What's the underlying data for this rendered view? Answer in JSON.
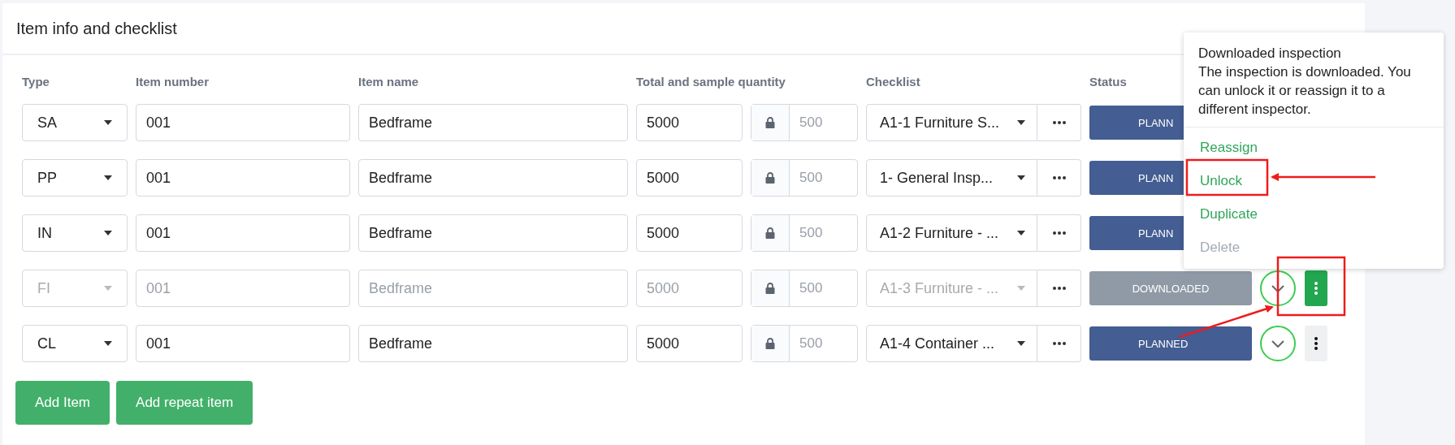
{
  "card": {
    "title": "Item info and checklist"
  },
  "columns": [
    "Type",
    "Item number",
    "Item name",
    "Total and sample quantity",
    "Checklist",
    "Status"
  ],
  "rows": [
    {
      "type": "SA",
      "item_number": "001",
      "item_name": "Bedframe",
      "total_quantity": "5000",
      "sample_quantity": "500",
      "checklist": "A1-1 Furniture S...",
      "status": {
        "kind": "planned",
        "label": "PLANN"
      },
      "disabled": false
    },
    {
      "type": "PP",
      "item_number": "001",
      "item_name": "Bedframe",
      "total_quantity": "5000",
      "sample_quantity": "500",
      "checklist": "1- General Insp...",
      "status": {
        "kind": "planned",
        "label": "PLANN"
      },
      "disabled": false
    },
    {
      "type": "IN",
      "item_number": "001",
      "item_name": "Bedframe",
      "total_quantity": "5000",
      "sample_quantity": "500",
      "checklist": "A1-2 Furniture - ...",
      "status": {
        "kind": "planned",
        "label": "PLANN"
      },
      "disabled": false
    },
    {
      "type": "FI",
      "item_number": "001",
      "item_name": "Bedframe",
      "total_quantity": "5000",
      "sample_quantity": "500",
      "checklist": "A1-3 Furniture - ...",
      "status": {
        "kind": "downloaded",
        "label": "DOWNLOADED"
      },
      "disabled": true,
      "actions": {
        "menu_open": true
      }
    },
    {
      "type": "CL",
      "item_number": "001",
      "item_name": "Bedframe",
      "total_quantity": "5000",
      "sample_quantity": "500",
      "checklist": "A1-4 Container ...",
      "status": {
        "kind": "planned",
        "label": "PLANNED"
      },
      "disabled": false,
      "actions": {
        "menu_open": false
      }
    }
  ],
  "buttons": [
    "Add Item",
    "Add repeat item"
  ],
  "menu": {
    "title": "Downloaded inspection",
    "description": "The inspection is downloaded. You can unlock it or reassign it to a different inspector.",
    "items": [
      {
        "label": "Reassign",
        "disabled": false
      },
      {
        "label": "Unlock",
        "disabled": false
      },
      {
        "label": "Duplicate",
        "disabled": false
      },
      {
        "label": "Delete",
        "disabled": true
      }
    ]
  }
}
